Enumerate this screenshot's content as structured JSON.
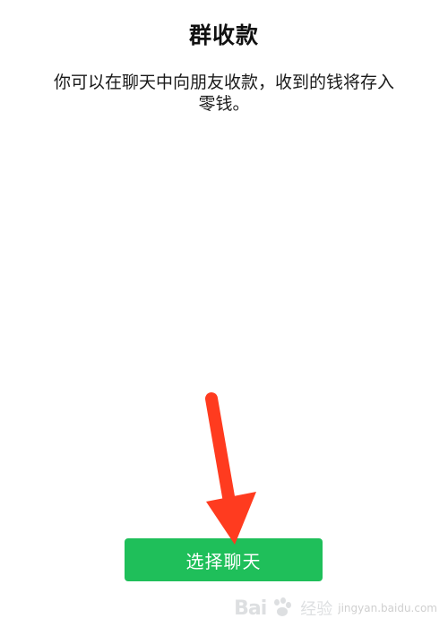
{
  "screen": {
    "title": "群收款",
    "description": "你可以在聊天中向朋友收款，收到的钱将存入零钱。"
  },
  "actions": {
    "select_chat_label": "选择聊天"
  },
  "annotation": {
    "arrow_color": "#ff3b1f",
    "button_color": "#1fbf5a"
  },
  "watermark": {
    "brand": "Bai",
    "site": "经验",
    "url": "jingyan.baidu.com"
  }
}
